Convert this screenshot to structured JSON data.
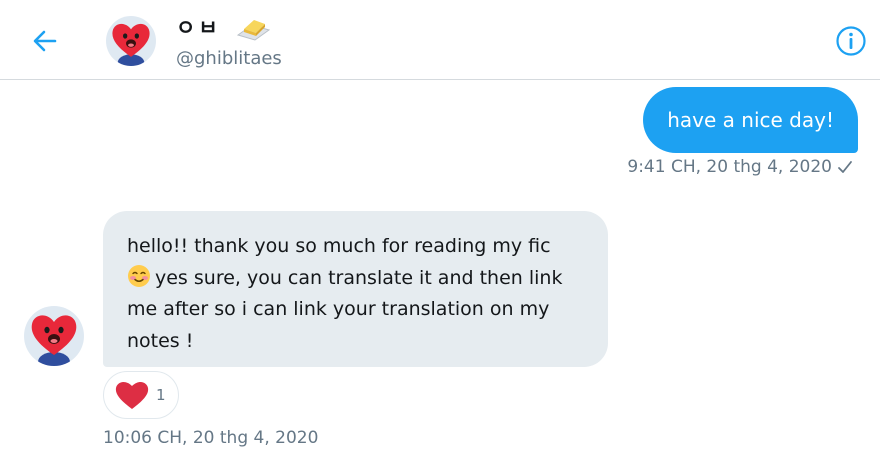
{
  "header": {
    "display_name": "ㅇㅂ",
    "handle": "@ghiblitaes",
    "avatar_icon": "tata-heart-character-icon",
    "name_emoji_icon": "butter-icon",
    "back_icon": "arrow-left-icon",
    "info_icon": "info-circle-icon"
  },
  "messages": [
    {
      "direction": "sent",
      "text": "have a nice day!",
      "timestamp": "9:41 CH, 20 thg 4, 2020",
      "status_icon": "checkmark-icon"
    },
    {
      "direction": "received",
      "text_before_emoji": "hello!! thank you so much for reading my fic",
      "emoji": "smiling-face-icon",
      "text_after_emoji": "yes sure, you can translate it and then link me after so i can link your translation on my notes !",
      "reaction": {
        "icon": "heart-icon",
        "count": "1"
      },
      "timestamp": "10:06 CH, 20 thg 4, 2020"
    }
  ],
  "colors": {
    "accent": "#1da1f2",
    "received_bubble": "#e6ecf0",
    "meta_text": "#657786",
    "heart": "#e0245e"
  }
}
